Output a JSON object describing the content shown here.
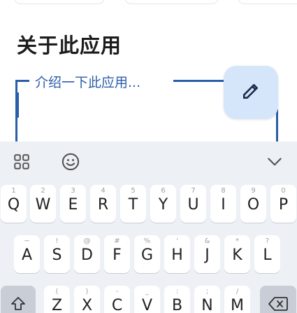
{
  "about": {
    "title": "关于此应用",
    "field_label": "介绍一下此应用..."
  },
  "icons": {
    "edit": "pencil-icon",
    "apps": "grid-icon",
    "emoji": "emoji-icon",
    "collapse": "chevron-down-icon",
    "shift": "shift-icon",
    "backspace": "backspace-icon"
  },
  "colors": {
    "accent": "#2a5ea8",
    "fab_bg": "#d6e6fa",
    "keyboard_bg": "#edf0f5"
  },
  "keyboard": {
    "row1": [
      {
        "ch": "Q",
        "hint": "1"
      },
      {
        "ch": "W",
        "hint": "2"
      },
      {
        "ch": "E",
        "hint": "3"
      },
      {
        "ch": "R",
        "hint": "4"
      },
      {
        "ch": "T",
        "hint": "5"
      },
      {
        "ch": "Y",
        "hint": "6"
      },
      {
        "ch": "U",
        "hint": "7"
      },
      {
        "ch": "I",
        "hint": "8"
      },
      {
        "ch": "O",
        "hint": "9"
      },
      {
        "ch": "P",
        "hint": "0"
      }
    ],
    "row2": [
      {
        "ch": "A",
        "hint": "~"
      },
      {
        "ch": "S",
        "hint": "!"
      },
      {
        "ch": "D",
        "hint": "@"
      },
      {
        "ch": "F",
        "hint": "#"
      },
      {
        "ch": "G",
        "hint": "%"
      },
      {
        "ch": "H",
        "hint": "'"
      },
      {
        "ch": "J",
        "hint": "&"
      },
      {
        "ch": "K",
        "hint": "*"
      },
      {
        "ch": "L",
        "hint": "?"
      }
    ],
    "row3": [
      {
        "ch": "Z",
        "hint": "("
      },
      {
        "ch": "X",
        "hint": ")"
      },
      {
        "ch": "C",
        "hint": "-"
      },
      {
        "ch": "V",
        "hint": "_"
      },
      {
        "ch": "B",
        "hint": ":"
      },
      {
        "ch": "N",
        "hint": ";"
      },
      {
        "ch": "M",
        "hint": "/"
      }
    ]
  }
}
